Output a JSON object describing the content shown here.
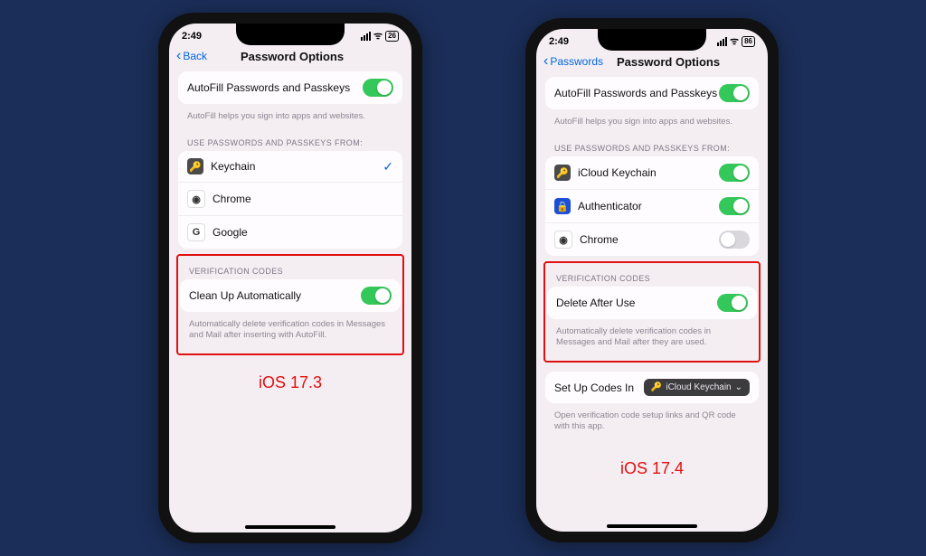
{
  "left": {
    "status": {
      "time": "2:49",
      "battery": "26"
    },
    "nav": {
      "back": "Back",
      "title": "Password Options"
    },
    "autofill": {
      "label": "AutoFill Passwords and Passkeys",
      "on": true
    },
    "autofill_hint": "AutoFill helps you sign into apps and websites.",
    "providers_header": "USE PASSWORDS AND PASSKEYS FROM:",
    "providers": [
      {
        "name": "Keychain",
        "icon_bg": "#4a4a4a",
        "icon_txt": "🔑",
        "checked": true
      },
      {
        "name": "Chrome",
        "icon_bg": "#fff",
        "icon_txt": "◉"
      },
      {
        "name": "Google",
        "icon_bg": "#fff",
        "icon_txt": "G"
      }
    ],
    "verif_header": "VERIFICATION CODES",
    "verif_toggle": {
      "label": "Clean Up Automatically",
      "on": true
    },
    "verif_hint": "Automatically delete verification codes in Messages and Mail after inserting with AutoFill.",
    "caption": "iOS 17.3"
  },
  "right": {
    "status": {
      "time": "2:49",
      "battery": "86"
    },
    "nav": {
      "back": "Passwords",
      "title": "Password Options"
    },
    "autofill": {
      "label": "AutoFill Passwords and Passkeys",
      "on": true
    },
    "autofill_hint": "AutoFill helps you sign into apps and websites.",
    "providers_header": "USE PASSWORDS AND PASSKEYS FROM:",
    "providers": [
      {
        "name": "iCloud Keychain",
        "icon_bg": "#4a4a4a",
        "icon_txt": "🔑",
        "toggle": true
      },
      {
        "name": "Authenticator",
        "icon_bg": "#1a4fd6",
        "icon_txt": "🔒",
        "toggle": true
      },
      {
        "name": "Chrome",
        "icon_bg": "#fff",
        "icon_txt": "◉",
        "toggle": false
      }
    ],
    "verif_header": "VERIFICATION CODES",
    "verif_toggle": {
      "label": "Delete After Use",
      "on": true
    },
    "verif_hint": "Automatically delete verification codes in Messages and Mail after they are used.",
    "setup": {
      "label": "Set Up Codes In",
      "value": "iCloud Keychain"
    },
    "setup_hint": "Open verification code setup links and QR code with this app.",
    "caption": "iOS 17.4"
  }
}
